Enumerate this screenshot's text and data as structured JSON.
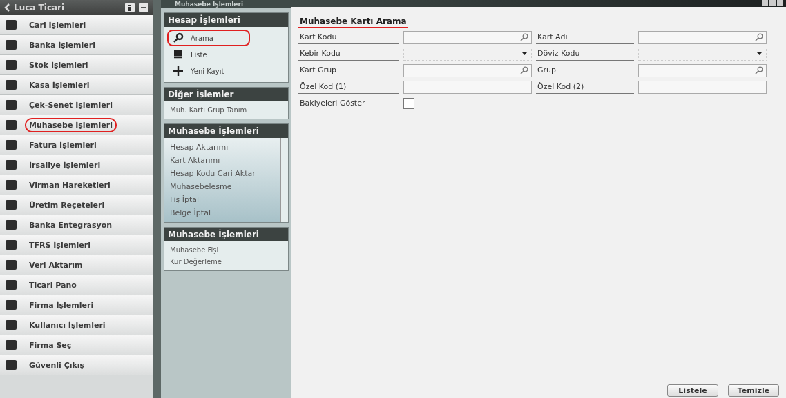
{
  "sidebar": {
    "title": "Luca Ticari",
    "items": [
      {
        "label": "Cari İşlemleri",
        "selected": false
      },
      {
        "label": "Banka İşlemleri",
        "selected": false
      },
      {
        "label": "Stok İşlemleri",
        "selected": false
      },
      {
        "label": "Kasa İşlemleri",
        "selected": false
      },
      {
        "label": "Çek-Senet İşlemleri",
        "selected": false
      },
      {
        "label": "Muhasebe İşlemleri",
        "selected": true
      },
      {
        "label": "Fatura İşlemleri",
        "selected": false
      },
      {
        "label": "İrsaliye İşlemleri",
        "selected": false
      },
      {
        "label": "Virman Hareketleri",
        "selected": false
      },
      {
        "label": "Üretim Reçeteleri",
        "selected": false
      },
      {
        "label": "Banka Entegrasyon",
        "selected": false
      },
      {
        "label": "TFRS İşlemleri",
        "selected": false
      },
      {
        "label": "Veri Aktarım",
        "selected": false
      },
      {
        "label": "Ticari Pano",
        "selected": false
      },
      {
        "label": "Firma İşlemleri",
        "selected": false
      },
      {
        "label": "Kullanıcı İşlemleri",
        "selected": false
      },
      {
        "label": "Firma Seç",
        "selected": false
      },
      {
        "label": "Güvenli Çıkış",
        "selected": false
      }
    ]
  },
  "window": {
    "title": "Muhasebe İşlemleri"
  },
  "panels": [
    {
      "title": "Hesap İşlemleri",
      "kind": "icons",
      "items": [
        {
          "label": "Arama",
          "selected": true
        },
        {
          "label": "Liste",
          "selected": false
        },
        {
          "label": "Yeni Kayıt",
          "selected": false
        }
      ]
    },
    {
      "title": "Diğer İşlemler",
      "kind": "links",
      "items": [
        {
          "label": "Muh. Kartı Grup Tanım"
        }
      ]
    },
    {
      "title": "Muhasebe İşlemleri",
      "kind": "scroll",
      "items": [
        {
          "label": "Hesap Aktarımı"
        },
        {
          "label": "Kart Aktarımı"
        },
        {
          "label": "Hesap Kodu Cari Aktar"
        },
        {
          "label": "Muhasebeleşme"
        },
        {
          "label": "Fiş İptal"
        },
        {
          "label": "Belge İptal"
        }
      ]
    },
    {
      "title": "Muhasebe İşlemleri",
      "kind": "links",
      "items": [
        {
          "label": "Muhasebe Fişi"
        },
        {
          "label": "Kur Değerleme"
        }
      ]
    }
  ],
  "form": {
    "title": "Muhasebe Kartı Arama",
    "fields": [
      {
        "label": "Kart Kodu",
        "kind": "search"
      },
      {
        "label": "Kart Adı",
        "kind": "search"
      },
      {
        "label": "Kebir Kodu",
        "kind": "dropdown"
      },
      {
        "label": "Döviz Kodu",
        "kind": "dropdown"
      },
      {
        "label": "Kart Grup",
        "kind": "search"
      },
      {
        "label": "Grup",
        "kind": "search"
      },
      {
        "label": "Özel Kod (1)",
        "kind": "text"
      },
      {
        "label": "Özel Kod (2)",
        "kind": "text"
      },
      {
        "label": "Bakiyeleri Göster",
        "kind": "checkbox",
        "checked": false
      }
    ]
  },
  "buttons": [
    "Listele",
    "Temizle"
  ]
}
